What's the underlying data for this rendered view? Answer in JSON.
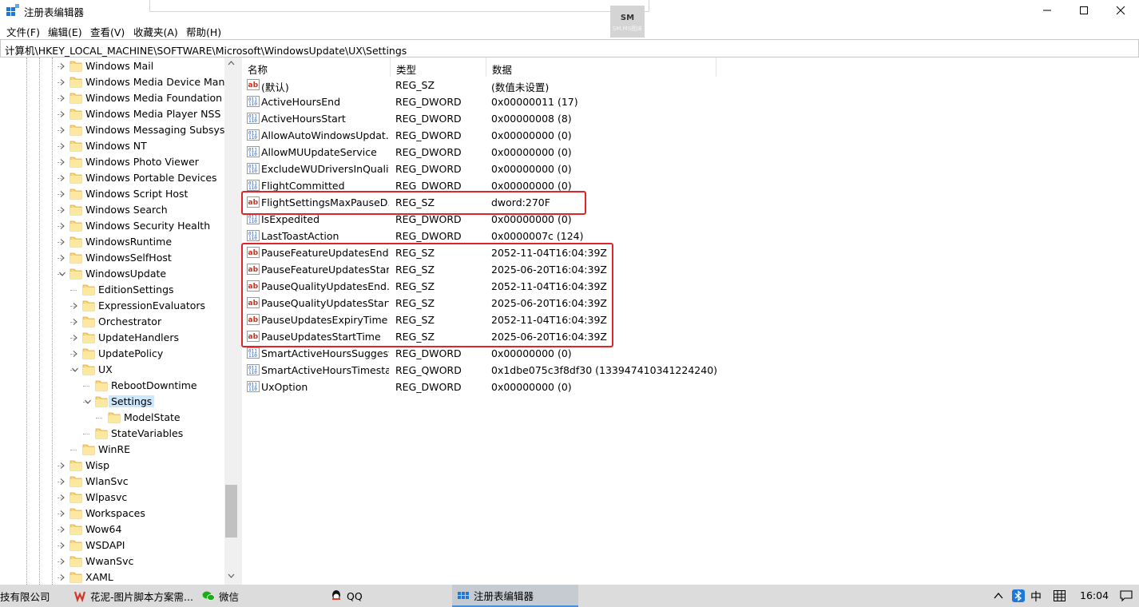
{
  "window": {
    "title": "注册表编辑器"
  },
  "watermark": {
    "line1": "SM",
    "line2": "SM.MS图床"
  },
  "menu": [
    {
      "label": "文件(F)"
    },
    {
      "label": "编辑(E)"
    },
    {
      "label": "查看(V)"
    },
    {
      "label": "收藏夹(A)"
    },
    {
      "label": "帮助(H)"
    }
  ],
  "address": "计算机\\HKEY_LOCAL_MACHINE\\SOFTWARE\\Microsoft\\WindowsUpdate\\UX\\Settings",
  "tree": [
    {
      "label": "Windows Mail",
      "level": 0,
      "expander": "collapsed"
    },
    {
      "label": "Windows Media Device Mana",
      "level": 0,
      "expander": "collapsed"
    },
    {
      "label": "Windows Media Foundation",
      "level": 0,
      "expander": "collapsed"
    },
    {
      "label": "Windows Media Player NSS",
      "level": 0,
      "expander": "collapsed"
    },
    {
      "label": "Windows Messaging Subsyste",
      "level": 0,
      "expander": "collapsed"
    },
    {
      "label": "Windows NT",
      "level": 0,
      "expander": "collapsed"
    },
    {
      "label": "Windows Photo Viewer",
      "level": 0,
      "expander": "collapsed"
    },
    {
      "label": "Windows Portable Devices",
      "level": 0,
      "expander": "collapsed"
    },
    {
      "label": "Windows Script Host",
      "level": 0,
      "expander": "collapsed"
    },
    {
      "label": "Windows Search",
      "level": 0,
      "expander": "collapsed"
    },
    {
      "label": "Windows Security Health",
      "level": 0,
      "expander": "collapsed"
    },
    {
      "label": "WindowsRuntime",
      "level": 0,
      "expander": "collapsed"
    },
    {
      "label": "WindowsSelfHost",
      "level": 0,
      "expander": "collapsed"
    },
    {
      "label": "WindowsUpdate",
      "level": 0,
      "expander": "expanded"
    },
    {
      "label": "EditionSettings",
      "level": 1,
      "expander": "none"
    },
    {
      "label": "ExpressionEvaluators",
      "level": 1,
      "expander": "collapsed"
    },
    {
      "label": "Orchestrator",
      "level": 1,
      "expander": "collapsed"
    },
    {
      "label": "UpdateHandlers",
      "level": 1,
      "expander": "collapsed"
    },
    {
      "label": "UpdatePolicy",
      "level": 1,
      "expander": "collapsed"
    },
    {
      "label": "UX",
      "level": 1,
      "expander": "expanded"
    },
    {
      "label": "RebootDowntime",
      "level": 2,
      "expander": "none"
    },
    {
      "label": "Settings",
      "level": 2,
      "expander": "expanded",
      "selected": true
    },
    {
      "label": "ModelState",
      "level": 3,
      "expander": "none"
    },
    {
      "label": "StateVariables",
      "level": 2,
      "expander": "none"
    },
    {
      "label": "WinRE",
      "level": 1,
      "expander": "none"
    },
    {
      "label": "Wisp",
      "level": 0,
      "expander": "collapsed"
    },
    {
      "label": "WlanSvc",
      "level": 0,
      "expander": "collapsed"
    },
    {
      "label": "Wlpasvc",
      "level": 0,
      "expander": "collapsed"
    },
    {
      "label": "Workspaces",
      "level": 0,
      "expander": "collapsed"
    },
    {
      "label": "Wow64",
      "level": 0,
      "expander": "collapsed"
    },
    {
      "label": "WSDAPI",
      "level": 0,
      "expander": "collapsed"
    },
    {
      "label": "WwanSvc",
      "level": 0,
      "expander": "collapsed"
    },
    {
      "label": "XAML",
      "level": 0,
      "expander": "collapsed"
    }
  ],
  "columns": {
    "name": "名称",
    "type": "类型",
    "data": "数据"
  },
  "values": [
    {
      "name": "(默认)",
      "type": "REG_SZ",
      "data": "(数值未设置)",
      "icon": "string"
    },
    {
      "name": "ActiveHoursEnd",
      "type": "REG_DWORD",
      "data": "0x00000011 (17)",
      "icon": "binary"
    },
    {
      "name": "ActiveHoursStart",
      "type": "REG_DWORD",
      "data": "0x00000008 (8)",
      "icon": "binary"
    },
    {
      "name": "AllowAutoWindowsUpdat...",
      "type": "REG_DWORD",
      "data": "0x00000000 (0)",
      "icon": "binary"
    },
    {
      "name": "AllowMUUpdateService",
      "type": "REG_DWORD",
      "data": "0x00000000 (0)",
      "icon": "binary"
    },
    {
      "name": "ExcludeWUDriversInQualit...",
      "type": "REG_DWORD",
      "data": "0x00000000 (0)",
      "icon": "binary"
    },
    {
      "name": "FlightCommitted",
      "type": "REG_DWORD",
      "data": "0x00000000 (0)",
      "icon": "binary"
    },
    {
      "name": "FlightSettingsMaxPauseD...",
      "type": "REG_SZ",
      "data": "dword:270F",
      "icon": "string"
    },
    {
      "name": "IsExpedited",
      "type": "REG_DWORD",
      "data": "0x00000000 (0)",
      "icon": "binary"
    },
    {
      "name": "LastToastAction",
      "type": "REG_DWORD",
      "data": "0x0000007c (124)",
      "icon": "binary"
    },
    {
      "name": "PauseFeatureUpdatesEnd...",
      "type": "REG_SZ",
      "data": "2052-11-04T16:04:39Z",
      "icon": "string"
    },
    {
      "name": "PauseFeatureUpdatesStar...",
      "type": "REG_SZ",
      "data": "2025-06-20T16:04:39Z",
      "icon": "string"
    },
    {
      "name": "PauseQualityUpdatesEnd...",
      "type": "REG_SZ",
      "data": "2052-11-04T16:04:39Z",
      "icon": "string"
    },
    {
      "name": "PauseQualityUpdatesStart...",
      "type": "REG_SZ",
      "data": "2025-06-20T16:04:39Z",
      "icon": "string"
    },
    {
      "name": "PauseUpdatesExpiryTime",
      "type": "REG_SZ",
      "data": "2052-11-04T16:04:39Z",
      "icon": "string"
    },
    {
      "name": "PauseUpdatesStartTime",
      "type": "REG_SZ",
      "data": "2025-06-20T16:04:39Z",
      "icon": "string"
    },
    {
      "name": "SmartActiveHoursSuggest...",
      "type": "REG_DWORD",
      "data": "0x00000000 (0)",
      "icon": "binary"
    },
    {
      "name": "SmartActiveHoursTimesta...",
      "type": "REG_QWORD",
      "data": "0x1dbe075c3f8df30 (133947410341224240)",
      "icon": "binary"
    },
    {
      "name": "UxOption",
      "type": "REG_DWORD",
      "data": "0x00000000 (0)",
      "icon": "binary"
    }
  ],
  "highlight_color": "#e0242b",
  "taskbar": {
    "items": [
      {
        "label": "技有限公司",
        "icon": ""
      },
      {
        "label": "花泥-图片脚本方案需...",
        "icon": "wps-icon"
      },
      {
        "label": "微信",
        "icon": "wechat-icon"
      },
      {
        "label": "QQ",
        "icon": "qq-icon"
      },
      {
        "label": "注册表编辑器",
        "icon": "regedit-icon",
        "active": true
      }
    ],
    "tray": {
      "ime": "中",
      "time": "16:04"
    }
  }
}
